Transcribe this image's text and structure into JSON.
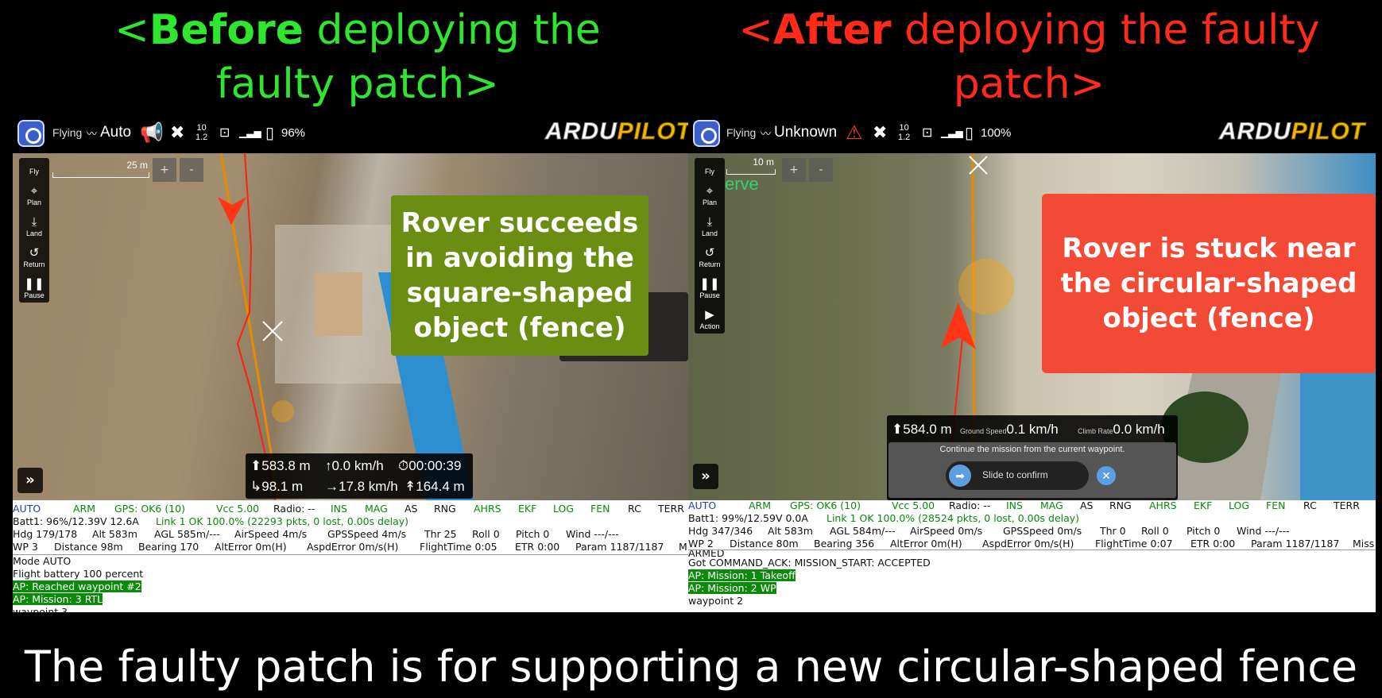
{
  "headline_left": {
    "open": "<",
    "bold": "Before",
    "rest1": " deploying the",
    "rest2": "faulty patch>"
  },
  "headline_right": {
    "open": "<",
    "bold": "After",
    "rest1": " deploying the faulty",
    "rest2": "patch>"
  },
  "caption": "The faulty patch is for supporting a new circular-shaped fence",
  "colors": {
    "before": "#2ee62e",
    "after": "#ff2a1a",
    "callout_green": "#6b8e12",
    "callout_red": "#f24a34"
  },
  "left": {
    "topbar": {
      "flying": "Flying",
      "mode": "Auto",
      "sats": "10",
      "hdop": "1.2",
      "battery": "96%"
    },
    "brand": {
      "a": "ARDU",
      "b": "PILOT"
    },
    "tools": [
      "Fly",
      "Plan",
      "Land",
      "Return",
      "Pause"
    ],
    "scale": "25 m",
    "zoom": [
      "+",
      "-"
    ],
    "callout": "Rover succeeds in avoiding the square-shaped object (fence)",
    "telemetry": {
      "alt": "583.8 m",
      "vspeed": "0.0 km/h",
      "time": "00:00:39",
      "dist": "98.1 m",
      "hspeed": "17.8 km/h",
      "home": "164.4 m"
    },
    "expand": "»",
    "status_flags": [
      "AUTO",
      "ARM",
      "GPS: OK6 (10)",
      "Vcc 5.00",
      "Radio: --",
      "INS",
      "MAG",
      "AS",
      "RNG",
      "AHRS",
      "EKF",
      "LOG",
      "FEN",
      "RC",
      "TERR"
    ],
    "row2": {
      "batt": "Batt1: 96%/12.39V 12.6A",
      "link": "Link 1 OK 100.0% (22293 pkts, 0 lost, 0.00s delay)"
    },
    "row3": [
      "Hdg 179/178",
      "Alt 583m",
      "AGL 585m/---",
      "AirSpeed 4m/s",
      "GPSSpeed 4m/s",
      "Thr 25",
      "Roll 0",
      "Pitch 0",
      "Wind ---/---"
    ],
    "row4": [
      "WP 3",
      "Distance 98m",
      "Bearing 170",
      "AltError 0m(H)",
      "AspdError 0m/s(H)",
      "FlightTime 0:05",
      "ETR 0:00",
      "Param 1187/1187",
      "M"
    ],
    "log": [
      {
        "text": "Mode AUTO",
        "hl": false
      },
      {
        "text": "Flight battery 100 percent",
        "hl": false
      },
      {
        "text": "AP: Reached waypoint #2",
        "hl": true
      },
      {
        "text": "AP: Mission: 3 RTL",
        "hl": true
      },
      {
        "text": "waypoint 3",
        "hl": false
      }
    ]
  },
  "right": {
    "topbar": {
      "flying": "Flying",
      "mode": "Unknown",
      "sats": "10",
      "hdop": "1.2",
      "battery": "100%"
    },
    "brand": {
      "a": "ARDU",
      "b": "PILOT"
    },
    "tools": [
      "Fly",
      "Plan",
      "Land",
      "Return",
      "Pause",
      "Action"
    ],
    "scale": "10 m",
    "map_label": "erve",
    "zoom": [
      "+",
      "-"
    ],
    "callout": "Rover is stuck near the circular-shaped object (fence)",
    "telemetry": {
      "alt": "584.0 m",
      "gs_label": "Ground Speed",
      "gs": "0.1 km/h",
      "cr_label": "Climb Rate",
      "cr": "0.0 km/h",
      "prompt": "Continue the mission from the current waypoint.",
      "slider": "Slide to confirm"
    },
    "expand": "»",
    "status_flags": [
      "AUTO",
      "ARM",
      "GPS: OK6 (10)",
      "Vcc 5.00",
      "Radio: --",
      "INS",
      "MAG",
      "AS",
      "RNG",
      "AHRS",
      "EKF",
      "LOG",
      "FEN",
      "RC",
      "TERR"
    ],
    "row2": {
      "batt": "Batt1: 99%/12.59V 0.0A",
      "link": "Link 1 OK 100.0% (28524 pkts, 0 lost, 0.00s delay)"
    },
    "row3": [
      "Hdg 347/346",
      "Alt 583m",
      "AGL 584m/---",
      "AirSpeed 0m/s",
      "GPSSpeed 0m/s",
      "Thr 0",
      "Roll 0",
      "Pitch 0",
      "Wind ---/---"
    ],
    "row4": [
      "WP 2",
      "Distance 80m",
      "Bearing 356",
      "AltError 0m(H)",
      "AspdError 0m/s(H)",
      "FlightTime 0:07",
      "ETR 0:00",
      "Param 1187/1187",
      "Miss"
    ],
    "log": [
      {
        "text": "ARMED",
        "hl": false
      },
      {
        "text": "Got COMMAND_ACK: MISSION_START: ACCEPTED",
        "hl": false
      },
      {
        "text": "AP: Mission: 1 Takeoff",
        "hl": true
      },
      {
        "text": "AP: Mission: 2 WP",
        "hl": true
      },
      {
        "text": "waypoint 2",
        "hl": false
      }
    ]
  }
}
